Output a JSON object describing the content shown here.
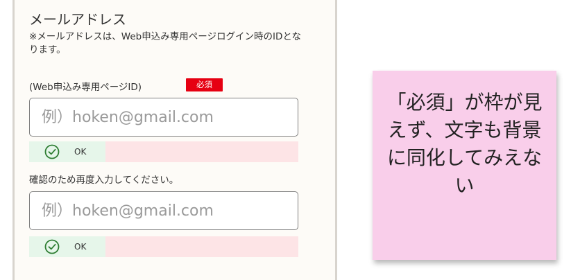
{
  "form": {
    "heading": "メールアドレス",
    "note": "※メールアドレスは、Web申込み専用ページログイン時のIDとなります。",
    "id_label": "(Web申込み専用ページID)",
    "required_badge": "必須",
    "email_input": {
      "placeholder": "例）hoken@gmail.com",
      "value": ""
    },
    "email_validation": {
      "icon": "check-circle-icon",
      "status": "OK"
    },
    "confirm_label": "確認のため再度入力してください。",
    "confirm_input": {
      "placeholder": "例）hoken@gmail.com",
      "value": ""
    },
    "confirm_validation": {
      "icon": "check-circle-icon",
      "status": "OK"
    }
  },
  "sticky_note": {
    "text": "「必須」が枠が見えず、文字も背景に同化してみえない"
  },
  "colors": {
    "required_badge_bg": "#e60012",
    "ok_bg": "#e6f6ea",
    "error_bg": "#fde4e6",
    "sticky_bg": "#f9ceea",
    "check_icon": "#2e7d32"
  }
}
